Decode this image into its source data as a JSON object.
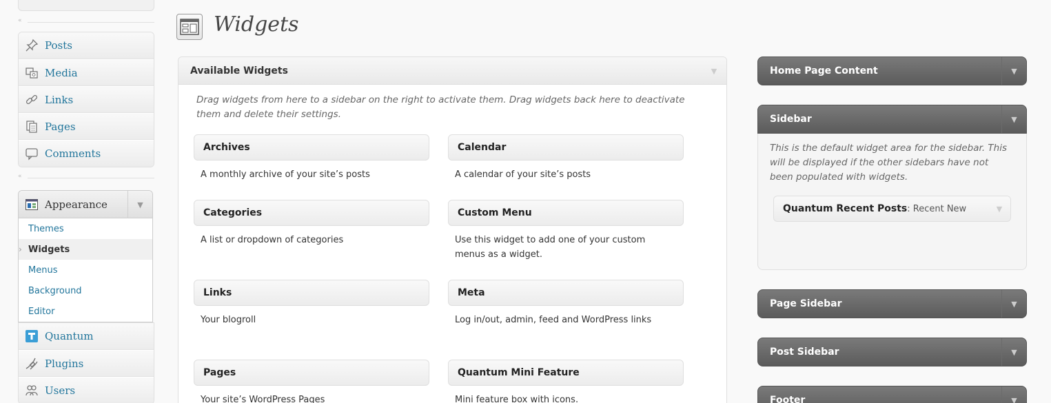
{
  "menu": {
    "group1": [
      {
        "label": "Posts",
        "icon": "pin-icon"
      },
      {
        "label": "Media",
        "icon": "media-icon"
      },
      {
        "label": "Links",
        "icon": "link-icon"
      },
      {
        "label": "Pages",
        "icon": "pages-icon"
      },
      {
        "label": "Comments",
        "icon": "comment-icon"
      }
    ],
    "appearance": {
      "label": "Appearance",
      "submenu": [
        "Themes",
        "Widgets",
        "Menus",
        "Background",
        "Editor"
      ],
      "current": "Widgets"
    },
    "group2": [
      {
        "label": "Quantum",
        "icon": "quantum-icon"
      },
      {
        "label": "Plugins",
        "icon": "plugin-icon"
      },
      {
        "label": "Users",
        "icon": "users-icon"
      }
    ],
    "separator_arrow": "«"
  },
  "page": {
    "title": "Widgets"
  },
  "available": {
    "title": "Available Widgets",
    "description": "Drag widgets from here to a sidebar on the right to activate them. Drag widgets back here to deactivate them and delete their settings.",
    "widgets": [
      {
        "name": "Archives",
        "desc": "A monthly archive of your site’s posts"
      },
      {
        "name": "Calendar",
        "desc": "A calendar of your site’s posts"
      },
      {
        "name": "Categories",
        "desc": "A list or dropdown of categories"
      },
      {
        "name": "Custom Menu",
        "desc": "Use this widget to add one of your custom menus as a widget."
      },
      {
        "name": "Links",
        "desc": "Your blogroll"
      },
      {
        "name": "Meta",
        "desc": "Log in/out, admin, feed and WordPress links"
      },
      {
        "name": "Pages",
        "desc": "Your site’s WordPress Pages"
      },
      {
        "name": "Quantum Mini Feature",
        "desc": "Mini feature box with icons."
      }
    ]
  },
  "sidebars": {
    "home": {
      "title": "Home Page Content"
    },
    "sidebar": {
      "title": "Sidebar",
      "description": "This is the default widget area for the sidebar. This will be displayed if the other sidebars have not been populated with widgets.",
      "widget_name": "Quantum Recent Posts",
      "widget_subtitle": ": Recent New"
    },
    "page": {
      "title": "Page Sidebar"
    },
    "post": {
      "title": "Post Sidebar"
    },
    "footer": {
      "title": "Footer"
    }
  },
  "colors": {
    "link": "#21759b",
    "sidebar_header": "#6a6a6a"
  }
}
